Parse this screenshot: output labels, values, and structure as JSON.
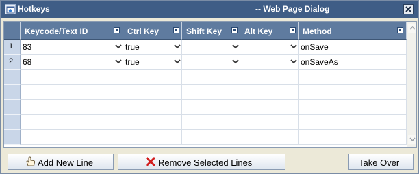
{
  "window": {
    "title": "Hotkeys",
    "subtitle": "-- Web Page Dialog",
    "close_icon": "close-icon"
  },
  "grid": {
    "columns": [
      {
        "label": "Keycode/Text ID"
      },
      {
        "label": "Ctrl Key"
      },
      {
        "label": "Shift Key"
      },
      {
        "label": "Alt Key"
      },
      {
        "label": "Method"
      }
    ],
    "rows": [
      {
        "num": "1",
        "keycode": "83",
        "ctrl": "true",
        "shift": "",
        "alt": "",
        "method": "onSave"
      },
      {
        "num": "2",
        "keycode": "68",
        "ctrl": "true",
        "shift": "",
        "alt": "",
        "method": "onSaveAs"
      }
    ]
  },
  "buttons": {
    "add_label": "Add New Line",
    "remove_label": "Remove Selected Lines",
    "takeover_label": "Take Over"
  },
  "colors": {
    "header_bg": "#5f7b9f",
    "titlebar_bg": "#3f5d86",
    "row_header_bg": "#c9d6e8"
  }
}
